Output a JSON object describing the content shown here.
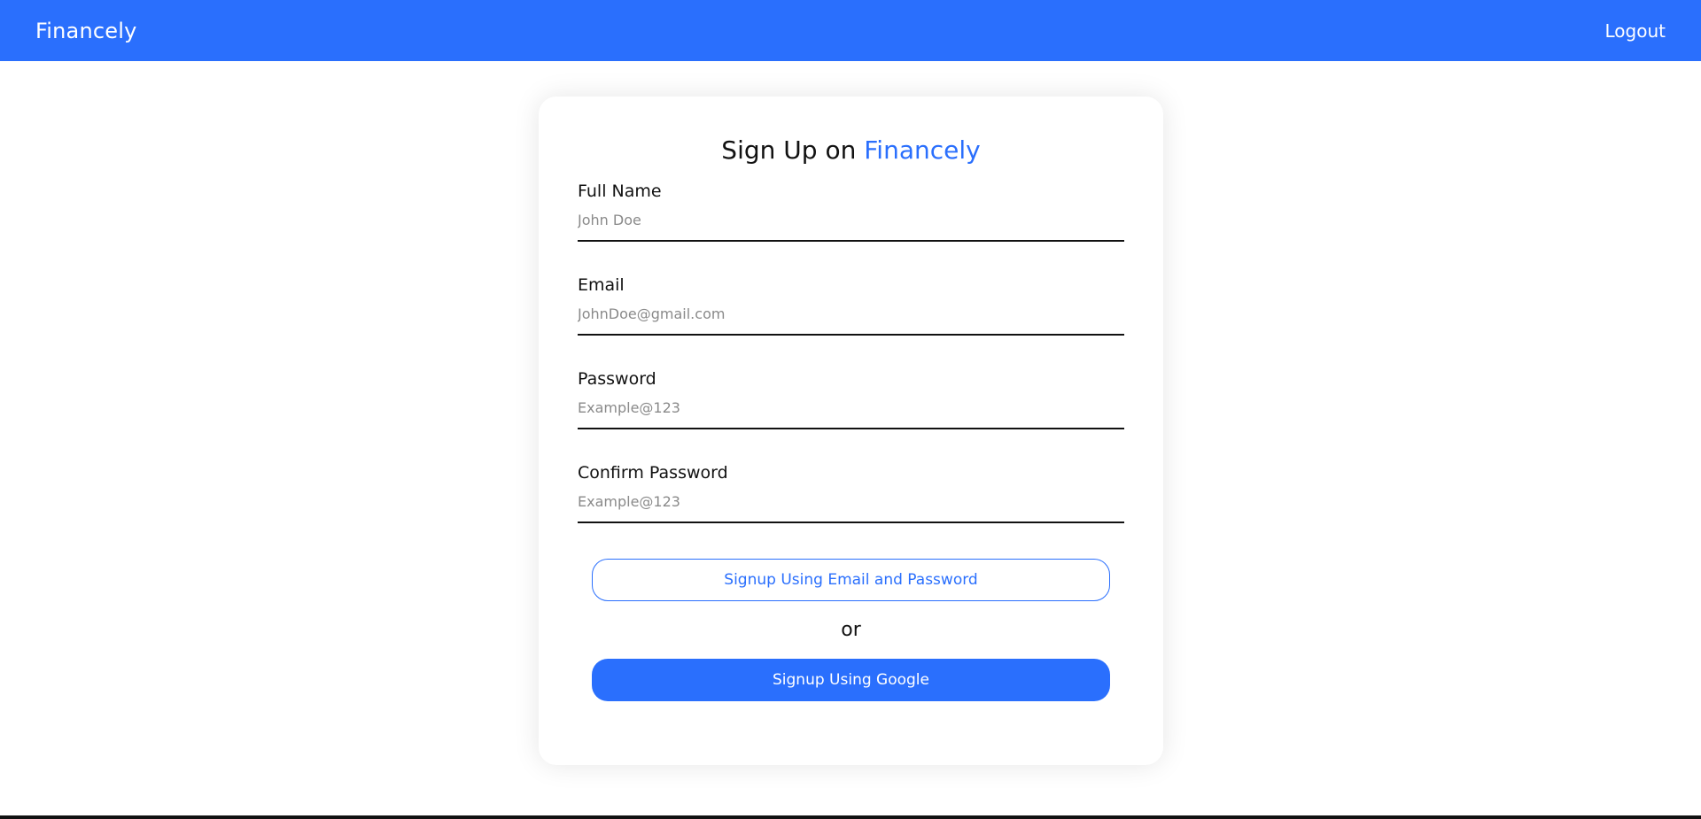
{
  "navbar": {
    "brand": "Financely",
    "logout_label": "Logout"
  },
  "signup": {
    "title_prefix": "Sign Up on ",
    "title_accent": "Financely",
    "fields": [
      {
        "label": "Full Name",
        "placeholder": "John Doe",
        "value": ""
      },
      {
        "label": "Email",
        "placeholder": "JohnDoe@gmail.com",
        "value": ""
      },
      {
        "label": "Password",
        "placeholder": "Example@123",
        "value": ""
      },
      {
        "label": "Confirm Password",
        "placeholder": "Example@123",
        "value": ""
      }
    ],
    "email_button_label": "Signup Using Email and Password",
    "or_text": "or",
    "google_button_label": "Signup Using Google"
  },
  "colors": {
    "primary": "#2a6ffd",
    "text": "#111111",
    "placeholder": "#8a8a8a",
    "background": "#ffffff"
  }
}
